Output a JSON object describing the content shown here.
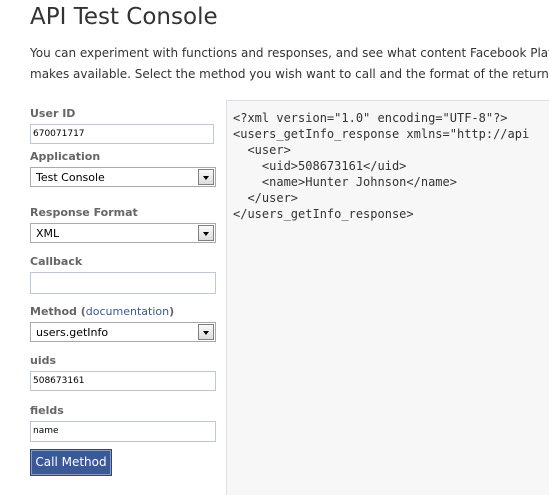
{
  "page": {
    "title": "API Test Console",
    "intro_line1": "You can experiment with functions and responses, and see what content Facebook Platform",
    "intro_line2": "makes available. Select the method you wish want to call and the format of the return valu"
  },
  "form": {
    "user_id_label": "User ID",
    "user_id_value": "670071717",
    "application_label": "Application",
    "application_selected": "Test Console",
    "response_format_label": "Response Format",
    "response_format_selected": "XML",
    "callback_label": "Callback",
    "callback_value": "",
    "method_label_prefix": "Method (",
    "method_doc_link": "documentation",
    "method_label_suffix": ")",
    "method_selected": "users.getInfo",
    "uids_label": "uids",
    "uids_value": "508673161",
    "fields_label": "fields",
    "fields_value": "name",
    "submit_label": "Call Method"
  },
  "output": {
    "lines": [
      "<?xml version=\"1.0\" encoding=\"UTF-8\"?>",
      "<users_getInfo_response xmlns=\"http://api",
      "  <user>",
      "    <uid>508673161</uid>",
      "    <name>Hunter Johnson</name>",
      "  </user>",
      "</users_getInfo_response>"
    ]
  }
}
